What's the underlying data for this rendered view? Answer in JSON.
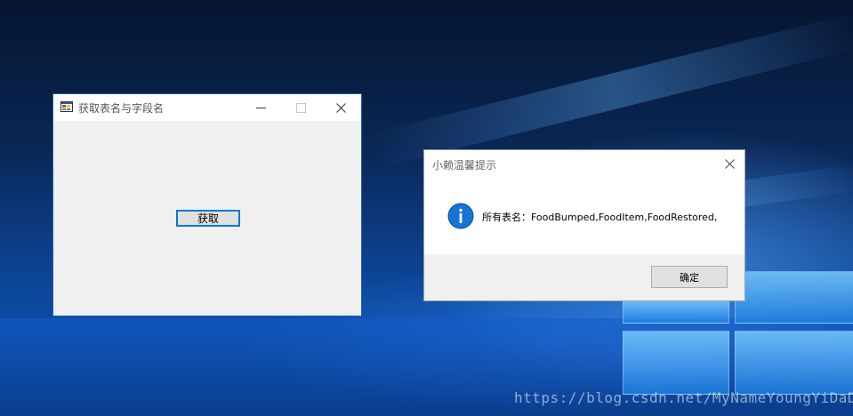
{
  "main_window": {
    "title": "获取表名与字段名",
    "get_button_label": "获取"
  },
  "message_box": {
    "title": "小赖温馨提示",
    "message": "所有表名：FoodBumped,FoodItem,FoodRestored,",
    "ok_label": "确定",
    "icon": "info-icon"
  },
  "watermark": {
    "text": "https://blog.csdn.net/MyNameYoungYiDaDai"
  },
  "colors": {
    "accent": "#0078d7",
    "window_border": "#1b5fa8",
    "dialog_bg": "#ffffff",
    "client_bg": "#f0f0f0"
  }
}
